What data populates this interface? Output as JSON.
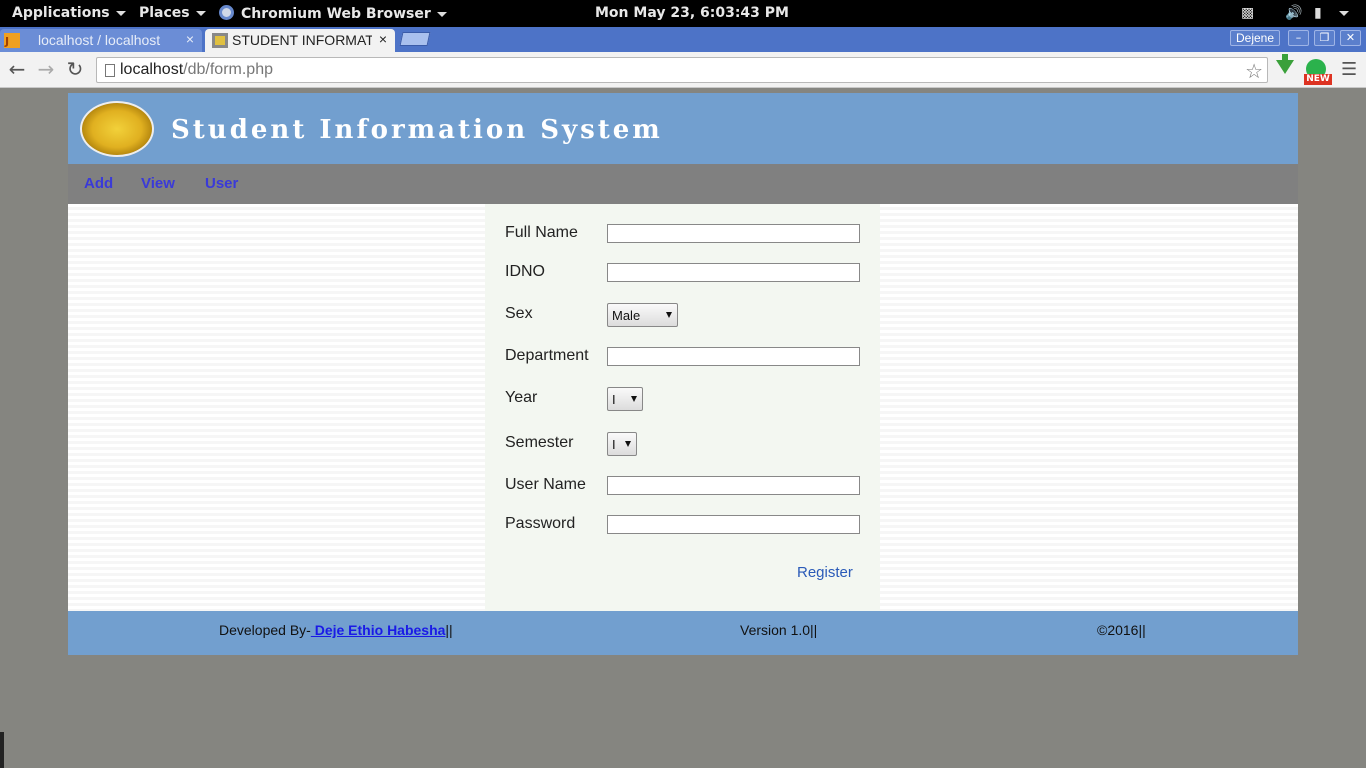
{
  "topbar": {
    "applications": "Applications",
    "places": "Places",
    "browser": "Chromium Web Browser",
    "clock": "Mon May 23,  6:03:43 PM"
  },
  "tabs": [
    {
      "label": "localhost / localhost",
      "close": "×"
    },
    {
      "label": "STUDENT INFORMATION SYSTEM",
      "close": "×"
    }
  ],
  "window": {
    "user": "Dejene"
  },
  "address": {
    "host": "localhost",
    "path": "/db/form.php"
  },
  "extensions": {
    "new_badge": "NEW"
  },
  "site": {
    "title": "Student Information System"
  },
  "nav": [
    "Add",
    "View",
    "User"
  ],
  "form": {
    "full_name_label": "Full Name",
    "idno_label": "IDNO",
    "sex_label": "Sex",
    "sex_value": "Male",
    "department_label": "Department",
    "year_label": "Year",
    "year_value": "I",
    "semester_label": "Semester",
    "semester_value": "I",
    "username_label": "User Name",
    "password_label": "Password",
    "register": "Register"
  },
  "footer": {
    "dev_prefix": "Developed By-",
    "dev_name": " Deje Ethio Habesha",
    "dev_suffix": "||",
    "version": "Version 1.0||",
    "copyright": "©2016||"
  }
}
